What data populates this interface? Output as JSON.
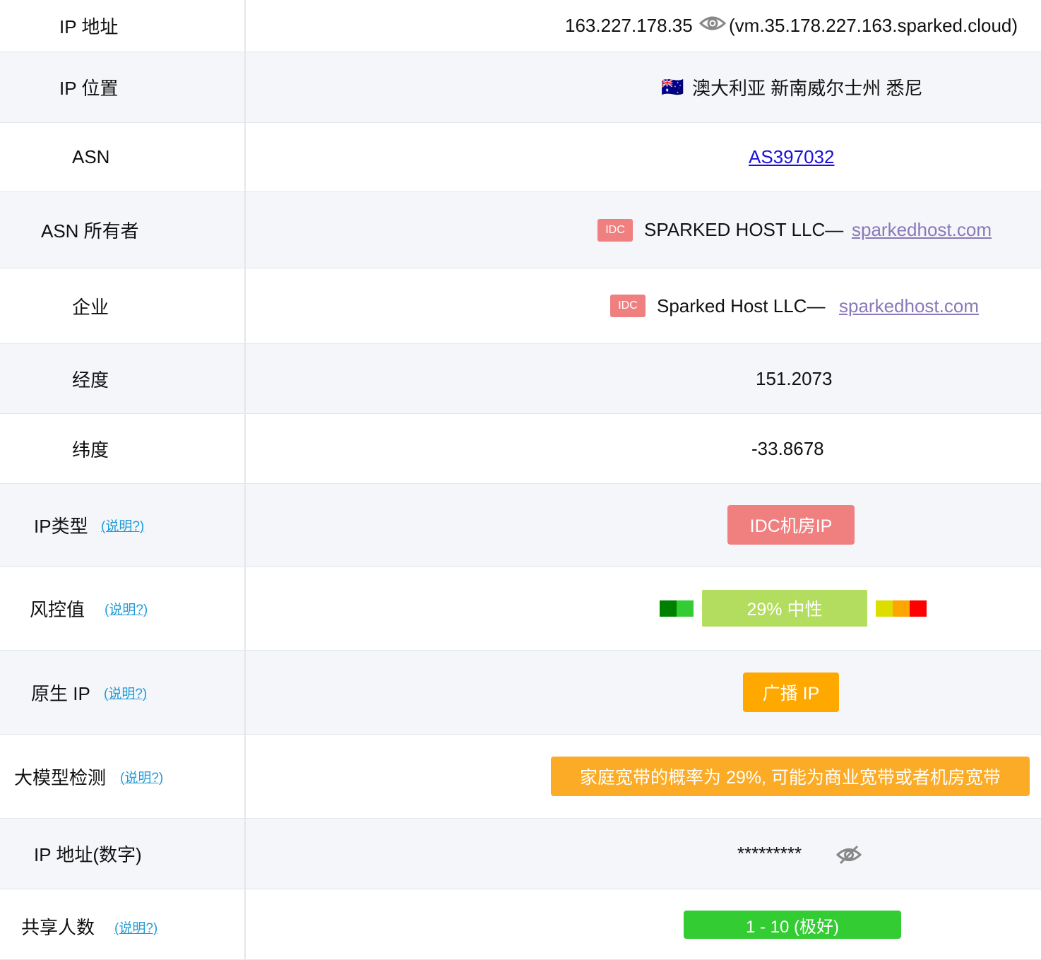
{
  "rows": {
    "ip_address": {
      "label": "IP 地址",
      "ip": "163.227.178.35",
      "hostname": "(vm.35.178.227.163.sparked.cloud)"
    },
    "ip_location": {
      "label": "IP 位置",
      "flag": "🇦🇺",
      "location": "澳大利亚 新南威尔士州 悉尼"
    },
    "asn": {
      "label": "ASN",
      "value": "AS397032"
    },
    "asn_owner": {
      "label": "ASN 所有者",
      "badge": "IDC",
      "name": "SPARKED HOST LLC—",
      "link": "sparkedhost.com"
    },
    "company": {
      "label": "企业",
      "badge": "IDC",
      "name": "Sparked Host LLC—",
      "link": "sparkedhost.com"
    },
    "longitude": {
      "label": "经度",
      "value": "151.2073"
    },
    "latitude": {
      "label": "纬度",
      "value": "-33.8678"
    },
    "ip_type": {
      "label": "IP类型",
      "help": "(说明?)",
      "value": "IDC机房IP"
    },
    "risk": {
      "label": "风控值",
      "help": "(说明?)",
      "value": "29%   中性",
      "level": 0.29
    },
    "native_ip": {
      "label": "原生 IP",
      "help": "(说明?)",
      "value": "广播 IP"
    },
    "llm_detect": {
      "label": "大模型检测",
      "help": "(说明?)",
      "value": "家庭宽带的概率为 29%, 可能为商业宽带或者机房宽带"
    },
    "ip_numeric": {
      "label": "IP 地址(数字)",
      "value": "*********"
    },
    "shared_users": {
      "label": "共享人数",
      "help": "(说明?)",
      "value": "1 - 10 (极好)"
    }
  },
  "colors": {
    "idc_red": "#f08080",
    "risk_neutral": "#b3dd5e",
    "broadcast_orange": "#ffa800",
    "llm_orange": "#fbab26",
    "good_green": "#33cc33",
    "risk_scale": [
      "#008000",
      "#33cc33",
      "#dddd00",
      "#ffa500",
      "#ff0000"
    ]
  }
}
